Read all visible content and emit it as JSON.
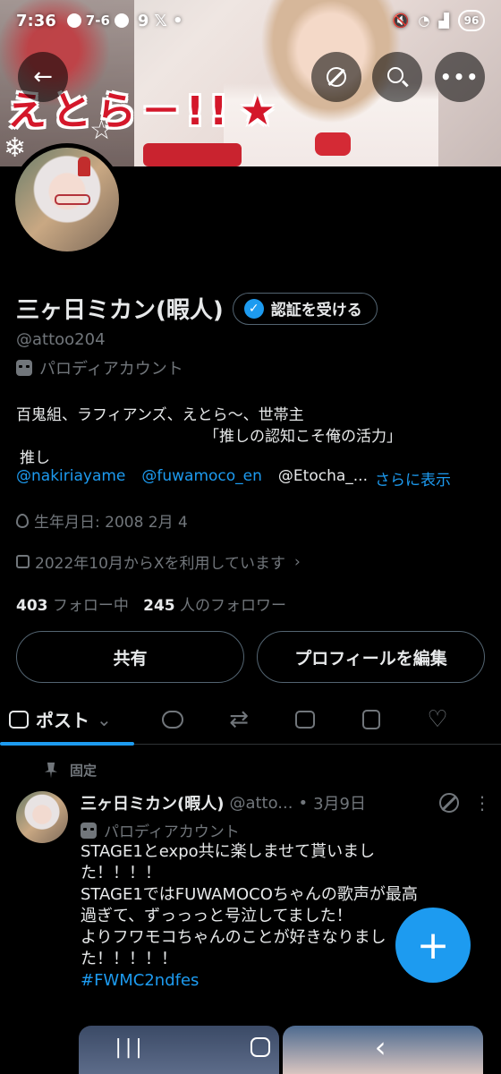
{
  "status_bar": {
    "time": "7:36",
    "score": "7-6",
    "notif_count": "9",
    "battery": "96"
  },
  "banner": {
    "text": "えとら－!!",
    "star": "★"
  },
  "profile": {
    "display_name": "三ヶ日ミカン(暇人)",
    "verify_label": "認証を受ける",
    "handle": "@attoo204",
    "parody_label": "パロディアカウント",
    "bio_line1": "百鬼組、ラフィアンズ、えとら～、世帯主",
    "bio_line2": "「推しの認知こそ俺の活力」",
    "bio_line3": "推し",
    "mentions": [
      "@nakiriayame",
      "@fuwamoco_en",
      "@Etocha_..."
    ],
    "more_label": "さらに表示",
    "birthday": "生年月日: 2008 2月 4",
    "joined": "2022年10月からXを利用しています",
    "following_count": "403",
    "following_label": "フォロー中",
    "followers_count": "245",
    "followers_label": "人のフォロワー",
    "share_label": "共有",
    "edit_label": "プロフィールを編集"
  },
  "tabs": {
    "posts_label": "ポスト"
  },
  "post": {
    "pinned_label": "固定",
    "name": "三ヶ日ミカン(暇人)",
    "handle": "@atto...",
    "dot": "•",
    "date": "3月9日",
    "parody_label": "パロディアカウント",
    "line1": "STAGE1とexpo共に楽しませて貰いまし",
    "line2": "た！！！！",
    "line3": "STAGE1ではFUWAMOCOちゃんの歌声が最高",
    "line4": "過ぎて、ずっっっと号泣してました！",
    "line5": "よりフワモコちゃんのことが好きなりまし",
    "line6": "た！！！！！",
    "hashtag": "#FWMC2ndfes"
  },
  "fab_label": "+",
  "colors": {
    "accent": "#1d9bf0",
    "muted": "#71767b",
    "text": "#e7e9ea",
    "border": "#536471"
  }
}
